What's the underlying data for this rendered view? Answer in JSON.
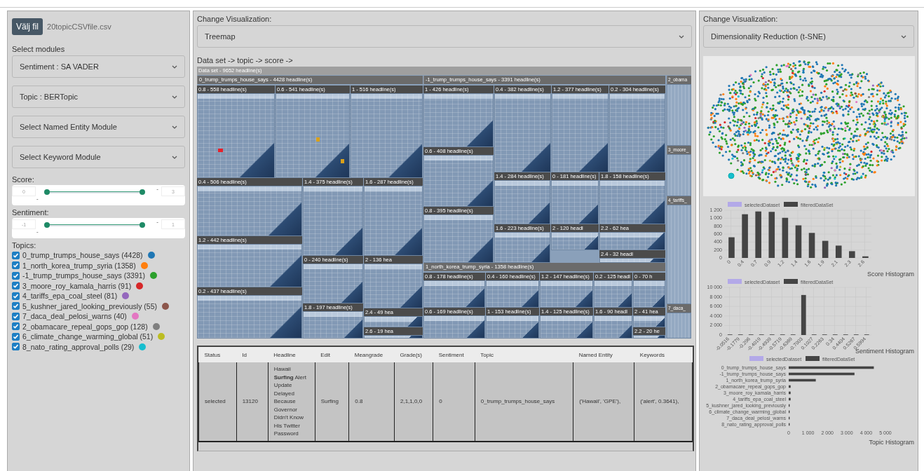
{
  "left": {
    "file_button": "Välj fil",
    "file_name": "20topicCSVfile.csv",
    "modules_label": "Select modules",
    "module_selects": [
      {
        "text": "Sentiment : SA VADER"
      },
      {
        "text": "Topic : BERTopic"
      },
      {
        "text": "Select Named Entity Module"
      },
      {
        "text": "Select Keyword Module"
      }
    ],
    "sliders": [
      {
        "label": "Score:",
        "min": "0",
        "max": "3",
        "separators": [
          "-",
          "-"
        ],
        "thumbs": [
          {
            "level": 0
          },
          {
            "level": 1
          }
        ]
      },
      {
        "label": "Sentiment:",
        "min": "-1",
        "max": "1",
        "separators": [
          "-",
          "-"
        ],
        "thumbs": [
          {
            "level": 0
          },
          {
            "level": 1
          }
        ]
      }
    ],
    "topics_label": "Topics:",
    "topics": [
      {
        "label": "0_trump_trumps_house_says (4428)",
        "checked": true,
        "color": "#1f77b4"
      },
      {
        "label": "1_north_korea_trump_syria (1358)",
        "checked": true,
        "color": "#ff7f0e"
      },
      {
        "label": "-1_trump_trumps_house_says (3391)",
        "checked": true,
        "color": "#2ca02c"
      },
      {
        "label": "3_moore_roy_kamala_harris (91)",
        "checked": true,
        "color": "#d62728"
      },
      {
        "label": "4_tariffs_epa_coal_steel (81)",
        "checked": true,
        "color": "#9467bd"
      },
      {
        "label": "5_kushner_jared_looking_previously (55)",
        "checked": true,
        "color": "#8c564b"
      },
      {
        "label": "7_daca_deal_pelosi_warns (40)",
        "checked": true,
        "color": "#e377c2"
      },
      {
        "label": "2_obamacare_repeal_gops_gop (128)",
        "checked": true,
        "color": "#7f7f7f"
      },
      {
        "label": "6_climate_change_warming_global (51)",
        "checked": true,
        "color": "#bcbd22"
      },
      {
        "label": "8_nato_rating_approval_polls (29)",
        "checked": true,
        "color": "#17becf"
      }
    ]
  },
  "middle": {
    "viz_label": "Change Visualization:",
    "viz_select": "Treemap",
    "breadcrumb": "Data set -> topic -> score ->",
    "treemap": {
      "root": "Data set - 9652 headline(s)",
      "topics": [
        {
          "label": "0_trump_trumps_house_says - 4428 headline(s)",
          "children": [
            "0.8 - 558 headline(s)",
            "0.6 - 541 headline(s)",
            "1 - 516 headline(s)",
            "0.4 - 506 headline(s)",
            "1.4 - 375 headline(s)",
            "1.6 - 287 headline(s)",
            "1.2 - 442 headline(s)",
            "0.2 - 437 headline(s)",
            "0 - 240 headline(s)",
            "1.8 - 197 headline(s)",
            "2 - 136 hea",
            "2.4 - 49 hea",
            "2.6 - 19 hea"
          ]
        },
        {
          "label": "-1_trump_trumps_house_says - 3391 headline(s)",
          "children": [
            "1 - 426 headline(s)",
            "0.4 - 382 headline(s)",
            "1.2 - 377 headline(s)",
            "0.2 - 304 headline(s)",
            "0.6 - 408 headline(s)",
            "0.8 - 395 headline(s)",
            "1.4 - 284 headline(s)",
            "0 - 181 headline(s)",
            "1.8 - 158 headline(s)",
            "1.6 - 223 headline(s)",
            "2 - 120 headl",
            "2.2 - 62 hea",
            "2.4 - 32 headl"
          ]
        },
        {
          "label": "2_obama"
        },
        {
          "label": "1_north_korea_trump_syria - 1358 headline(s)",
          "children": [
            "0.8 - 178 headline(s)",
            "0.4 - 160 headline(s)",
            "1.2 - 147 headline(s)",
            "0.2 - 125 headl",
            "0 - 70 h",
            "0.6 - 169 headline(s)",
            "1 - 153 headline(s)",
            "1.4 - 125 headline(s)",
            "1.6 - 90 headl",
            "2 - 41 hea",
            "2.2 - 20 he"
          ]
        },
        {
          "label": "3_moore_"
        },
        {
          "label": "4_tariffs_"
        },
        {
          "label": "7_daca_"
        }
      ]
    },
    "table": {
      "columns": [
        "Status",
        "Id",
        "Headline",
        "Edit",
        "Meangrade",
        "Grade(s)",
        "Sentiment",
        "Topic",
        "Named Entity",
        "Keywords"
      ],
      "rows": [
        {
          "selected": true,
          "cells": [
            "selected",
            "13120",
            "Hawaii **Surfing** Alert Update Delayed Because Governor Didn't Know His Twitter Password",
            "Surfing",
            "0.8",
            "2,1,1,0,0",
            "0",
            "0_trump_trumps_house_says",
            "('Hawaii', 'GPE'),",
            "('alert', 0.3641),"
          ]
        }
      ]
    }
  },
  "right": {
    "viz_label": "Change Visualization:",
    "viz_select": "Dimensionality Reduction (t-SNE)",
    "charts": [
      {
        "chart_data": {
          "type": "bar",
          "title": "Score Histogram",
          "categories": [
            "0",
            "0.4",
            "0.7",
            "0.9",
            "1.2",
            "1.4",
            "1.6",
            "1.9",
            "2.1",
            "2.3",
            "2.6"
          ],
          "series": [
            {
              "name": "selectedDataset",
              "color": "#b3a9e8",
              "values": [
                null,
                null,
                null,
                null,
                null,
                null,
                null,
                null,
                null,
                null,
                null
              ]
            },
            {
              "name": "filteredDataSet",
              "color": "#444444",
              "values": [
                520,
                1100,
                1170,
                1160,
                1010,
                820,
                630,
                430,
                310,
                170,
                40
              ]
            }
          ],
          "grid": true,
          "ylim": [
            0,
            1200
          ],
          "yticks": [
            0,
            {
              "value": 200,
              "label": "200"
            },
            {
              "value": 400,
              "label": "400"
            },
            {
              "value": 600,
              "label": "600"
            },
            {
              "value": 800,
              "label": "800"
            },
            {
              "value": 1000,
              "label": "1 000"
            },
            {
              "value": 1200,
              "label": "1 200"
            }
          ]
        }
      },
      {
        "chart_data": {
          "type": "bar",
          "title": "Sentiment Histogram",
          "categories": [
            "-0.0516",
            "-0.1779",
            "-0.296",
            "-0.4019",
            "-0.4939",
            "-0.5719",
            "-0.6369",
            "-0.7003",
            "0.1027",
            "0.2263",
            "0.34",
            "0.4404",
            "0.5267",
            "0.5994"
          ],
          "series": [
            {
              "name": "selectedDataset",
              "color": "#b3a9e8",
              "values": [
                null,
                null,
                null,
                null,
                null,
                null,
                null,
                null,
                null,
                null,
                null,
                null,
                null,
                null
              ]
            },
            {
              "name": "filteredDataSet",
              "color": "#444444",
              "values": [
                0,
                0,
                0,
                0,
                0,
                0,
                0,
                8400,
                0,
                0,
                0,
                0,
                0,
                0
              ]
            }
          ],
          "grid": true,
          "ylim": [
            0,
            10000
          ],
          "yticks": [
            0,
            {
              "value": 2000,
              "label": "2 000"
            },
            {
              "value": 4000,
              "label": "4 000"
            },
            {
              "value": 6000,
              "label": "6 000"
            },
            {
              "value": 8000,
              "label": "8 000"
            },
            {
              "value": 10000,
              "label": "10 000"
            }
          ]
        }
      },
      {
        "chart_data": {
          "type": "bar",
          "orientation": "horizontal",
          "title": "Topic Histogram",
          "categories": [
            "0_trump_trumps_house_says",
            "-1_trump_trumps_house_says",
            "1_north_korea_trump_syria",
            "2_obamacare_repeal_gops_gop",
            "3_moore_roy_kamala_harris",
            "4_tariffs_epa_coal_steel",
            "5_kushner_jared_looking_previously",
            "6_climate_change_warming_global",
            "7_daca_deal_pelosi_warns",
            "8_nato_rating_approval_polls"
          ],
          "series": [
            {
              "name": "selectedDataset",
              "color": "#b3a9e8",
              "values": [
                null,
                null,
                null,
                null,
                null,
                null,
                null,
                null,
                null,
                null
              ]
            },
            {
              "name": "filteredDataSet",
              "color": "#444444",
              "values": [
                4400,
                3400,
                1400,
                100,
                100,
                100,
                50,
                50,
                50,
                50
              ]
            }
          ],
          "xlim": [
            0,
            5000
          ],
          "xticks": [
            0,
            {
              "value": 1000,
              "label": "1 000"
            },
            {
              "value": 2000,
              "label": "2 000"
            },
            {
              "value": 3000,
              "label": "3 000"
            },
            {
              "value": 4000,
              "label": "4 000"
            },
            {
              "value": 5000,
              "label": "5 000"
            }
          ]
        }
      }
    ]
  }
}
